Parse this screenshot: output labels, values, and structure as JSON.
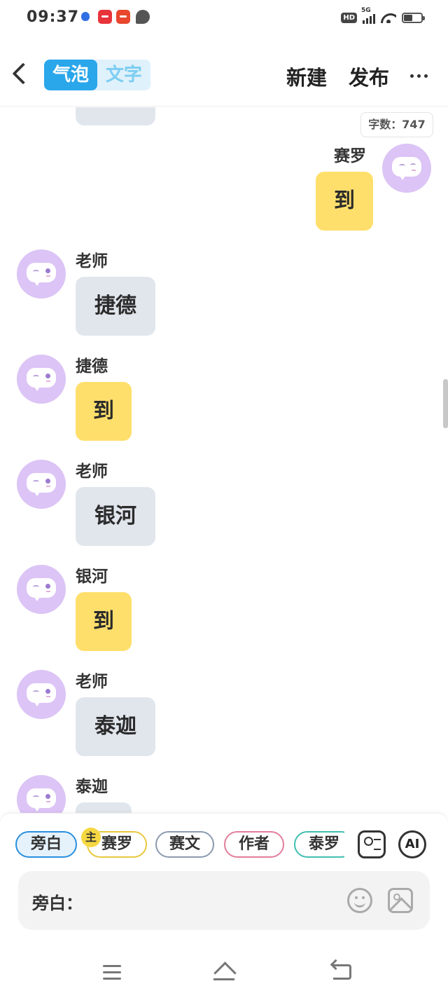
{
  "status_bar": {
    "time": "09:37",
    "hd_label": "HD",
    "network_label": "5G"
  },
  "header": {
    "segments": [
      "气泡",
      "文字"
    ],
    "active_segment": "气泡",
    "new_label": "新建",
    "publish_label": "发布"
  },
  "chat": {
    "word_count_label": "字数：747",
    "messages": [
      {
        "side": "right",
        "speaker": "赛罗",
        "text": "到",
        "bubble": "yellow"
      },
      {
        "side": "left",
        "speaker": "老师",
        "text": "捷德",
        "bubble": "gray"
      },
      {
        "side": "left",
        "speaker": "捷德",
        "text": "到",
        "bubble": "yellow"
      },
      {
        "side": "left",
        "speaker": "老师",
        "text": "银河",
        "bubble": "gray"
      },
      {
        "side": "left",
        "speaker": "银河",
        "text": "到",
        "bubble": "yellow"
      },
      {
        "side": "left",
        "speaker": "老师",
        "text": "泰迦",
        "bubble": "gray"
      },
      {
        "side": "left",
        "speaker": "泰迦",
        "text": "",
        "bubble": "gray"
      }
    ]
  },
  "composer": {
    "characters": [
      "旁白",
      "赛罗",
      "赛文",
      "作者",
      "泰罗"
    ],
    "selected_character": "旁白",
    "main_badge": "主",
    "ai_label": "AI",
    "input_prefix": "旁白：",
    "input_value": ""
  },
  "colors": {
    "accent": "#2aa6ea",
    "bubble_gray": "#e1e6ed",
    "bubble_yellow": "#ffdf6c",
    "avatar": "#dcc4f6"
  }
}
